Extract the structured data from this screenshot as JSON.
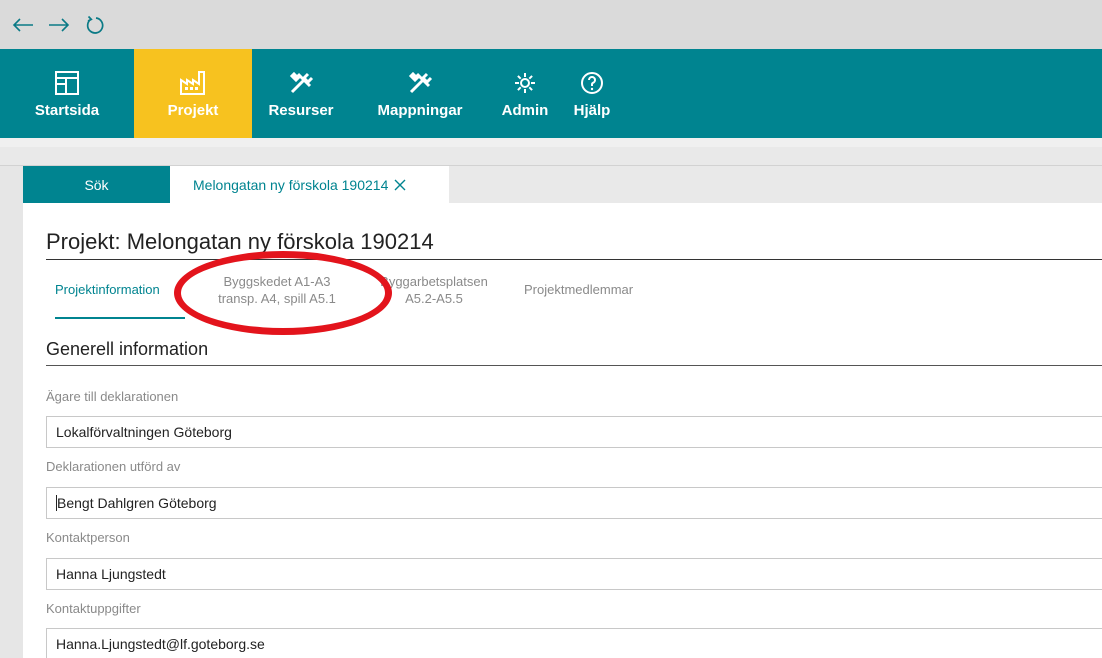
{
  "browser": {
    "back_icon": "arrow-left-icon",
    "forward_icon": "arrow-right-icon",
    "reload_icon": "refresh-icon"
  },
  "nav": {
    "items": [
      {
        "label": "Startsida",
        "icon": "dashboard-icon"
      },
      {
        "label": "Projekt",
        "icon": "factory-chart-icon",
        "active": true
      },
      {
        "label": "Resurser",
        "icon": "tools-icon"
      },
      {
        "label": "Mappningar",
        "icon": "tools-icon"
      },
      {
        "label": "Admin",
        "icon": "gear-icon"
      },
      {
        "label": "Hjälp",
        "icon": "help-icon"
      }
    ],
    "bg_color": "#008490",
    "active_color": "#f7c21f"
  },
  "tabs": {
    "search_label": "Sök",
    "project_label": "Melongatan ny förskola 190214"
  },
  "page": {
    "title": "Projekt: Melongatan ny förskola 190214"
  },
  "subtabs": [
    {
      "line1": "Projektinformation",
      "line2": ""
    },
    {
      "line1": "Byggskedet A1-A3",
      "line2": "transp. A4, spill A5.1"
    },
    {
      "line1": "Byggarbetsplatsen",
      "line2": "A5.2-A5.5"
    },
    {
      "line1": "Projektmedlemmar",
      "line2": ""
    }
  ],
  "section": {
    "title": "Generell information"
  },
  "fields": [
    {
      "label": "Ägare till deklarationen",
      "value": "Lokalförvaltningen Göteborg"
    },
    {
      "label": "Deklarationen utförd av",
      "value": "Bengt Dahlgren Göteborg"
    },
    {
      "label": "Kontaktperson",
      "value": "Hanna Ljungstedt"
    },
    {
      "label": "Kontaktuppgifter",
      "value": "Hanna.Ljungstedt@lf.goteborg.se"
    }
  ],
  "annotation_color": "#e3141c"
}
